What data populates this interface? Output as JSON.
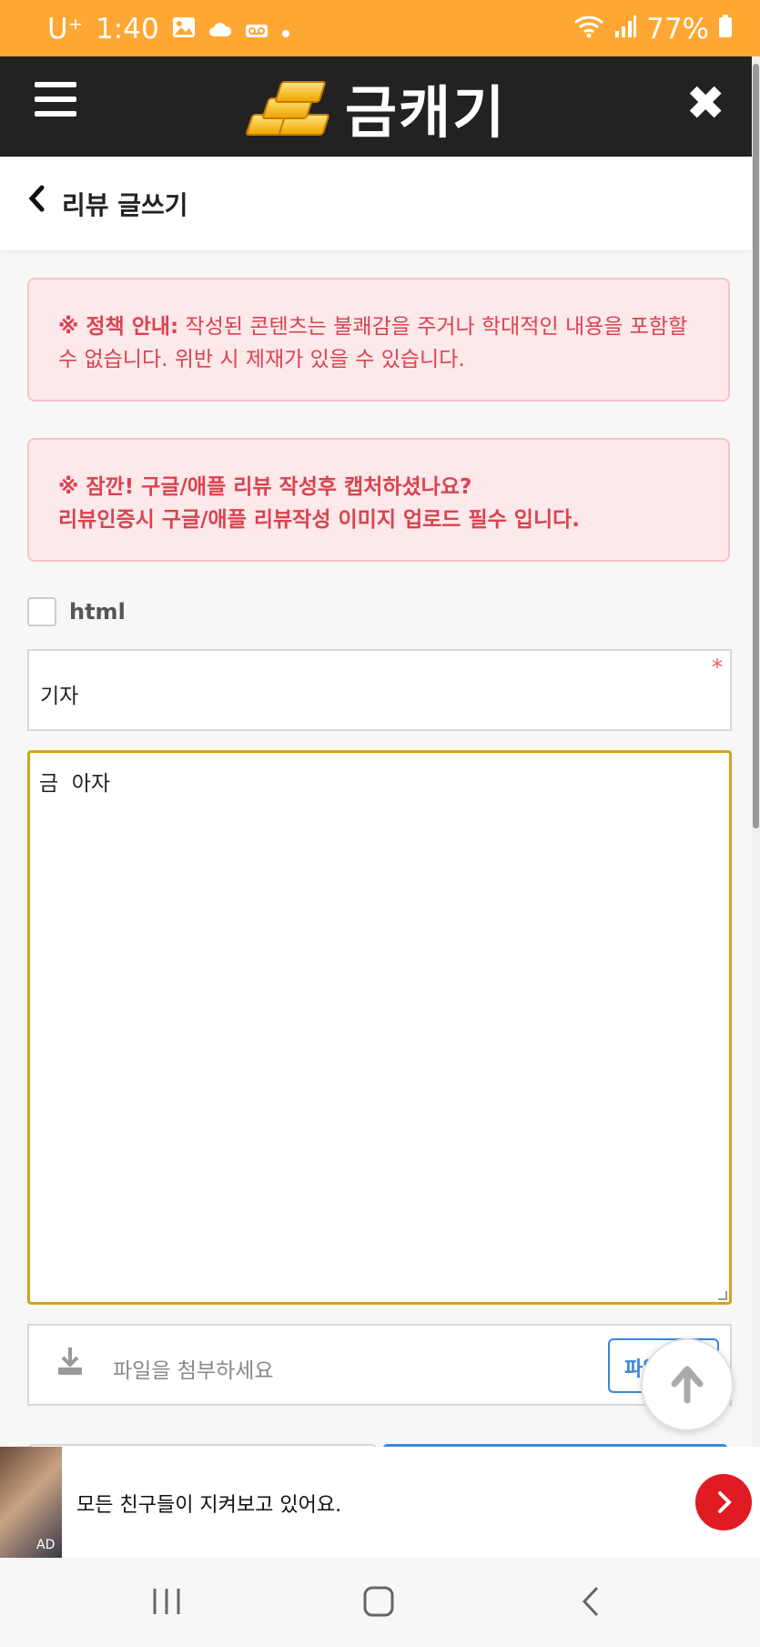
{
  "status": {
    "carrier": "U⁺",
    "time": "1:40",
    "battery": "77%",
    "icons": [
      "image-icon",
      "cloud-icon",
      "voicemail-icon",
      "dot-icon",
      "wifi-icon",
      "signal-icon",
      "battery-icon"
    ]
  },
  "appbar": {
    "title": "금캐기",
    "menu_icon": "hamburger-icon",
    "close_icon": "close-icon",
    "logo_icon": "gold-bars-icon"
  },
  "page": {
    "title": "리뷰 글쓰기",
    "back_icon": "chevron-left-icon"
  },
  "notices": {
    "policy_label": "※ 정책 안내:",
    "policy_text": " 작성된 콘텐츠는 불쾌감을 주거나 학대적인 내용을 포함할 수 없습니다. 위반 시 제재가 있을 수 있습니다.",
    "capture_line1": "※ 잠깐! 구글/애플 리뷰 작성후 캡처하셨나요?",
    "capture_line2": "리뷰인증시 구글/애플 리뷰작성 이미지 업로드 필수 입니다."
  },
  "form": {
    "html_label": "html",
    "html_checked": false,
    "subject_value": "기자",
    "required_mark": "*",
    "content_value": "금  아자",
    "file_placeholder": "파일을 첨부하세요",
    "file_button_label": "파일"
  },
  "ad": {
    "text": "모든 친구들이 지켜보고 있어요.",
    "tag": "AD",
    "accent": "#e01b22"
  },
  "colors": {
    "status_bar": "#ffa733",
    "app_bar": "#222222",
    "alert_bg": "#fde8ea",
    "alert_text": "#d9434f",
    "focus_border": "#d7a21a",
    "primary": "#3b86d8"
  }
}
